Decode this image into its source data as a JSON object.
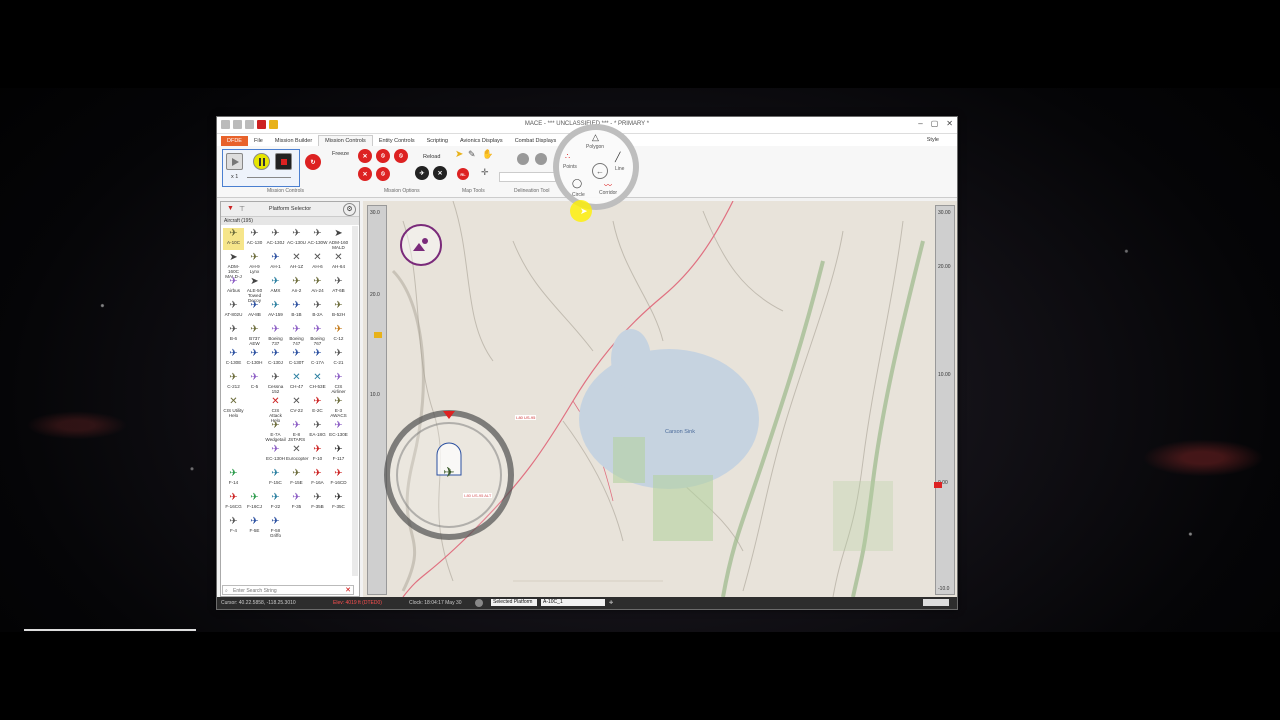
{
  "window": {
    "title": "MACE - *** UNCLASSIFIED *** - * PRIMARY *",
    "style_label": "Style"
  },
  "ribbon": {
    "tabs": [
      {
        "label": "DFDE",
        "kind": "file"
      },
      {
        "label": "File"
      },
      {
        "label": "Mission Builder"
      },
      {
        "label": "Mission Controls",
        "active": true
      },
      {
        "label": "Entity Controls"
      },
      {
        "label": "Scripting"
      },
      {
        "label": "Avionics Displays"
      },
      {
        "label": "Combat Displays"
      }
    ],
    "speed": "x 1",
    "freeze_label": "Freeze",
    "reload_label": "Reload",
    "groups": {
      "mission_controls": "Mission Controls",
      "mission_options": "Mission Options",
      "map_tools": "Map Tools",
      "delineation_tool": "Delineation Tool"
    }
  },
  "draw_menu": {
    "polygon": "Polygon",
    "points": "Points",
    "line": "Line",
    "circle": "Circle",
    "corridor": "Corridor"
  },
  "platform_selector": {
    "title": "Platform Selector",
    "category": "Aircraft (195)",
    "search_placeholder": "Enter Search String",
    "items": [
      {
        "name": "A-10C",
        "icon": "✈",
        "color": "#6b6b3a"
      },
      {
        "name": "AC-130",
        "icon": "✈",
        "color": "#555"
      },
      {
        "name": "AC-130J",
        "icon": "✈",
        "color": "#555"
      },
      {
        "name": "AC-130U",
        "icon": "✈",
        "color": "#555"
      },
      {
        "name": "AC-130W",
        "icon": "✈",
        "color": "#555"
      },
      {
        "name": "ADM-160 MALD",
        "icon": "➤",
        "color": "#444"
      },
      {
        "name": "ADM-160C MALD-J",
        "icon": "➤",
        "color": "#444"
      },
      {
        "name": "AH-9 Lynx",
        "icon": "✈",
        "color": "#6b6b3a"
      },
      {
        "name": "AH-1",
        "icon": "✈",
        "color": "#2a4fa0"
      },
      {
        "name": "AH-1Z",
        "icon": "✕",
        "color": "#555"
      },
      {
        "name": "AH-6",
        "icon": "✕",
        "color": "#555"
      },
      {
        "name": "AH-64",
        "icon": "✕",
        "color": "#555"
      },
      {
        "name": "Airbus",
        "icon": "✈",
        "color": "#8b5cc4"
      },
      {
        "name": "ALE-50 Towed Decoy",
        "icon": "➤",
        "color": "#444"
      },
      {
        "name": "AMX",
        "icon": "✈",
        "color": "#2a7fa0"
      },
      {
        "name": "An-2",
        "icon": "✈",
        "color": "#6b6b3a"
      },
      {
        "name": "An-24",
        "icon": "✈",
        "color": "#6b6b3a"
      },
      {
        "name": "AT-6B",
        "icon": "✈",
        "color": "#555"
      },
      {
        "name": "AT-802U",
        "icon": "✈",
        "color": "#555"
      },
      {
        "name": "AV-8B",
        "icon": "✈",
        "color": "#2a4fa0"
      },
      {
        "name": "AV-159",
        "icon": "✈",
        "color": "#2a7fa0"
      },
      {
        "name": "B-1B",
        "icon": "✈",
        "color": "#2a4fa0"
      },
      {
        "name": "B-2A",
        "icon": "✈",
        "color": "#555"
      },
      {
        "name": "B-52H",
        "icon": "✈",
        "color": "#6b6b3a"
      },
      {
        "name": "B-6",
        "icon": "✈",
        "color": "#555"
      },
      {
        "name": "B737 AEW",
        "icon": "✈",
        "color": "#6b6b3a"
      },
      {
        "name": "Boeing 737",
        "icon": "✈",
        "color": "#8b5cc4"
      },
      {
        "name": "Boeing 747",
        "icon": "✈",
        "color": "#8b5cc4"
      },
      {
        "name": "Boeing 767",
        "icon": "✈",
        "color": "#8b5cc4"
      },
      {
        "name": "C-12",
        "icon": "✈",
        "color": "#c47a1a"
      },
      {
        "name": "C-130E",
        "icon": "✈",
        "color": "#2a4fa0"
      },
      {
        "name": "C-130H",
        "icon": "✈",
        "color": "#2a4fa0"
      },
      {
        "name": "C-130J",
        "icon": "✈",
        "color": "#2a4fa0"
      },
      {
        "name": "C-130T",
        "icon": "✈",
        "color": "#2a4fa0"
      },
      {
        "name": "C-17A",
        "icon": "✈",
        "color": "#2a4fa0"
      },
      {
        "name": "C-21",
        "icon": "✈",
        "color": "#555"
      },
      {
        "name": "C-212",
        "icon": "✈",
        "color": "#6b6b3a"
      },
      {
        "name": "C-5",
        "icon": "✈",
        "color": "#8b5cc4"
      },
      {
        "name": "Cessna 152",
        "icon": "✈",
        "color": "#555"
      },
      {
        "name": "CH-47",
        "icon": "✕",
        "color": "#2a7fa0"
      },
      {
        "name": "CH-53E",
        "icon": "✕",
        "color": "#2a7fa0"
      },
      {
        "name": "CIS Airliner",
        "icon": "✈",
        "color": "#8b5cc4"
      },
      {
        "name": "CIS Utility Helo",
        "icon": "✕",
        "color": "#6b6b3a"
      },
      {
        "name": "",
        "icon": "",
        "color": "#fff"
      },
      {
        "name": "CIS Attack Helo",
        "icon": "✕",
        "color": "#c22"
      },
      {
        "name": "CV-22",
        "icon": "✕",
        "color": "#555"
      },
      {
        "name": "E-2C",
        "icon": "✈",
        "color": "#c22"
      },
      {
        "name": "E-3 AWACS",
        "icon": "✈",
        "color": "#6b6b3a"
      },
      {
        "name": "",
        "icon": "",
        "color": "#fff"
      },
      {
        "name": "",
        "icon": "",
        "color": "#fff"
      },
      {
        "name": "E-7A Wedgetail",
        "icon": "✈",
        "color": "#6b6b3a"
      },
      {
        "name": "E-8 JSTARS",
        "icon": "✈",
        "color": "#8b5cc4"
      },
      {
        "name": "EA-18G",
        "icon": "✈",
        "color": "#555"
      },
      {
        "name": "EC-130E",
        "icon": "✈",
        "color": "#8b5cc4"
      },
      {
        "name": "",
        "icon": "",
        "color": "#fff"
      },
      {
        "name": "",
        "icon": "",
        "color": "#fff"
      },
      {
        "name": "EC-130H",
        "icon": "✈",
        "color": "#8b5cc4"
      },
      {
        "name": "Eurocopter",
        "icon": "✕",
        "color": "#555"
      },
      {
        "name": "F-10",
        "icon": "✈",
        "color": "#c22"
      },
      {
        "name": "F-117",
        "icon": "✈",
        "color": "#333"
      },
      {
        "name": "F-14",
        "icon": "✈",
        "color": "#2a9a4a"
      },
      {
        "name": "",
        "icon": "",
        "color": "#fff"
      },
      {
        "name": "F-15C",
        "icon": "✈",
        "color": "#2a7fa0"
      },
      {
        "name": "F-15E",
        "icon": "✈",
        "color": "#6b6b3a"
      },
      {
        "name": "F-16A",
        "icon": "✈",
        "color": "#c22"
      },
      {
        "name": "F-16CD",
        "icon": "✈",
        "color": "#c22"
      },
      {
        "name": "F-16CG",
        "icon": "✈",
        "color": "#c22"
      },
      {
        "name": "F-16CJ",
        "icon": "✈",
        "color": "#2a9a4a"
      },
      {
        "name": "F-22",
        "icon": "✈",
        "color": "#2a7fa0"
      },
      {
        "name": "F-35",
        "icon": "✈",
        "color": "#8b5cc4"
      },
      {
        "name": "F-35B",
        "icon": "✈",
        "color": "#555"
      },
      {
        "name": "F-35C",
        "icon": "✈",
        "color": "#333"
      },
      {
        "name": "F-4",
        "icon": "✈",
        "color": "#555"
      },
      {
        "name": "F-5E",
        "icon": "✈",
        "color": "#2a4fa0"
      },
      {
        "name": "F-5II Griffo",
        "icon": "✈",
        "color": "#2a4fa0"
      }
    ]
  },
  "map": {
    "rulers": {
      "left_top": "30.0",
      "right_top": "30.00",
      "right_marks": [
        "30.00",
        "20.00",
        "10.00",
        "0.00",
        "-10.0"
      ],
      "left_marks": [
        "20.0",
        "10.0"
      ]
    },
    "labels": {
      "lake": "Carson Sink",
      "road1": "I-80 US-95 ALT",
      "road2": "I-80 US-95"
    }
  },
  "statusbar": {
    "cursor": "Cursor: 40.22.5858, -118.25.3010",
    "elev": "Elev: 4019 ft (DTED0)",
    "clock": "Clock: 18:04:17  May 30",
    "selected_platform_label": "Selected Platform",
    "selected_platform_value": "A-10C_1"
  }
}
